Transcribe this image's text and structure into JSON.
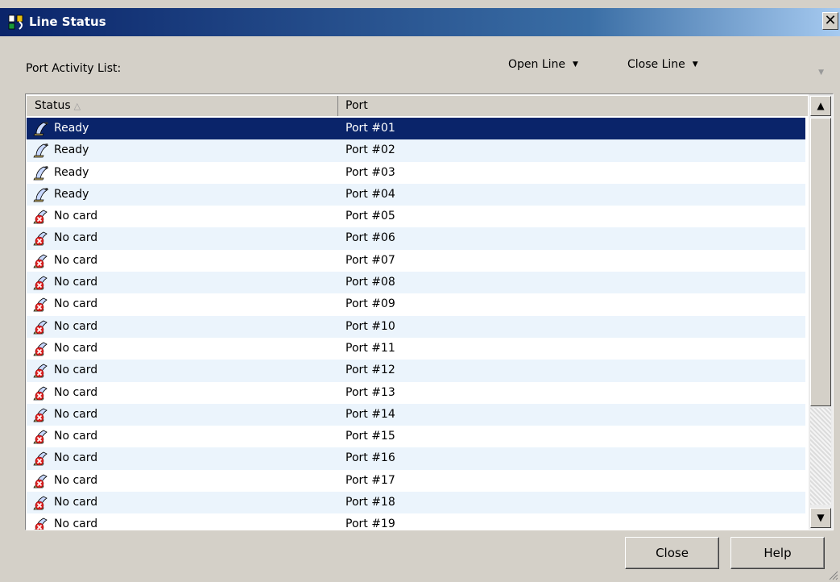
{
  "window": {
    "title": "Line Status",
    "close_glyph": "✕"
  },
  "toolbar": {
    "list_label": "Port Activity List:",
    "open_line": "Open Line",
    "close_line": "Close Line",
    "caret_glyph": "▼"
  },
  "columns": {
    "status": "Status",
    "port": "Port",
    "sort_glyph": "△"
  },
  "rows": [
    {
      "status": "Ready",
      "port": "Port #01",
      "icon": "phone-ready-icon",
      "selected": true
    },
    {
      "status": "Ready",
      "port": "Port #02",
      "icon": "phone-ready-icon"
    },
    {
      "status": "Ready",
      "port": "Port #03",
      "icon": "phone-ready-icon"
    },
    {
      "status": "Ready",
      "port": "Port #04",
      "icon": "phone-ready-icon"
    },
    {
      "status": "No card",
      "port": "Port #05",
      "icon": "phone-no-card-icon"
    },
    {
      "status": "No card",
      "port": "Port #06",
      "icon": "phone-no-card-icon"
    },
    {
      "status": "No card",
      "port": "Port #07",
      "icon": "phone-no-card-icon"
    },
    {
      "status": "No card",
      "port": "Port #08",
      "icon": "phone-no-card-icon"
    },
    {
      "status": "No card",
      "port": "Port #09",
      "icon": "phone-no-card-icon"
    },
    {
      "status": "No card",
      "port": "Port #10",
      "icon": "phone-no-card-icon"
    },
    {
      "status": "No card",
      "port": "Port #11",
      "icon": "phone-no-card-icon"
    },
    {
      "status": "No card",
      "port": "Port #12",
      "icon": "phone-no-card-icon"
    },
    {
      "status": "No card",
      "port": "Port #13",
      "icon": "phone-no-card-icon"
    },
    {
      "status": "No card",
      "port": "Port #14",
      "icon": "phone-no-card-icon"
    },
    {
      "status": "No card",
      "port": "Port #15",
      "icon": "phone-no-card-icon"
    },
    {
      "status": "No card",
      "port": "Port #16",
      "icon": "phone-no-card-icon"
    },
    {
      "status": "No card",
      "port": "Port #17",
      "icon": "phone-no-card-icon"
    },
    {
      "status": "No card",
      "port": "Port #18",
      "icon": "phone-no-card-icon"
    },
    {
      "status": "No card",
      "port": "Port #19",
      "icon": "phone-no-card-icon"
    }
  ],
  "scrollbar": {
    "up_glyph": "▲",
    "down_glyph": "▼"
  },
  "buttons": {
    "close": "Close",
    "help": "Help"
  },
  "colors": {
    "selection": "#0a246a",
    "alt_row": "#ebf4fc",
    "dialog_bg": "#d4d0c8",
    "error_red": "#e02020"
  }
}
